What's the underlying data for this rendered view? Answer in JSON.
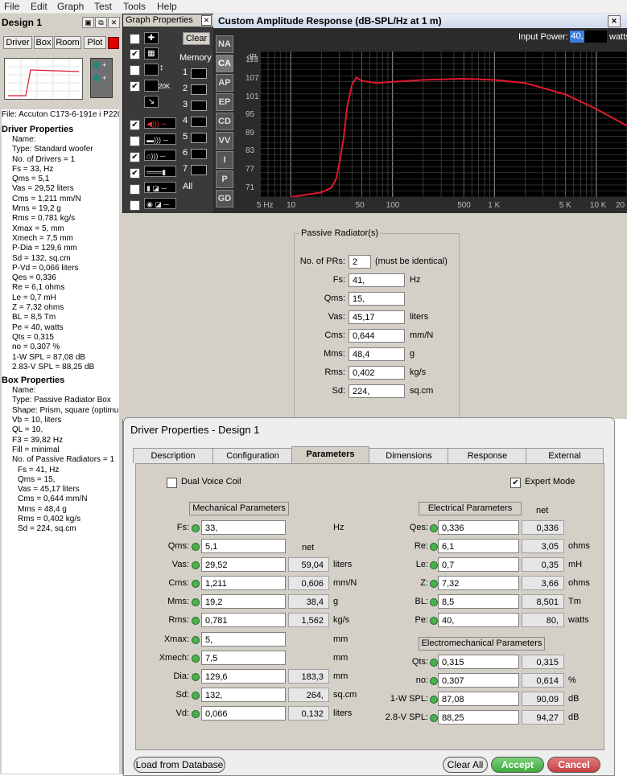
{
  "menu": [
    "File",
    "Edit",
    "Graph",
    "Test",
    "Tools",
    "Help"
  ],
  "design": {
    "title": "Design 1",
    "tabs": [
      "Driver",
      "Box",
      "Room",
      "Plot"
    ],
    "file_line": "File: Accuton C173-6-191e i P220",
    "driver_heading": "Driver Properties",
    "driver_props": [
      "Name:",
      "Type: Standard woofer",
      "No. of Drivers = 1",
      "Fs = 33, Hz",
      "Qms = 5,1",
      "Vas = 29,52 liters",
      "Cms = 1,211 mm/N",
      "Mms = 19,2 g",
      "Rms = 0,781 kg/s",
      "Xmax = 5, mm",
      "Xmech = 7,5 mm",
      "P-Dia = 129,6 mm",
      "Sd = 132, sq.cm",
      "P-Vd = 0,066 liters",
      "Qes = 0,336",
      "Re = 6,1 ohms",
      "Le = 0,7 mH",
      "Z = 7,32 ohms",
      "BL = 8,5 Tm",
      "Pe = 40, watts",
      "Qts = 0,315",
      "no = 0,307 %",
      "1-W SPL = 87,08 dB",
      "2.83-V SPL = 88,25 dB"
    ],
    "box_heading": "Box Properties",
    "box_props": [
      "Name:",
      "Type: Passive Radiator Box",
      "Shape: Prism, square (optimu",
      "Vb = 10, liters",
      "QL = 10,",
      "F3 = 39,82 Hz",
      "Fill = minimal",
      "No. of Passive Radiators = 1"
    ],
    "box_sub": [
      "Fs = 41, Hz",
      "Qms = 15,",
      "Vas = 45,17 liters",
      "Cms = 0,644 mm/N",
      "Mms = 48,4 g",
      "Rms = 0,402 kg/s",
      "Sd = 224, sq.cm"
    ]
  },
  "graph_props": {
    "title": "Graph Properties",
    "clear": "Clear",
    "memory": "Memory",
    "slots": [
      "1",
      "2",
      "3",
      "4",
      "5",
      "6",
      "7"
    ],
    "all": "All",
    "icon_20k": "20K"
  },
  "graph": {
    "title": "Custom Amplitude Response (dB-SPL/Hz at 1 m)",
    "input_power_label": "Input Power:",
    "input_power_value": "40,",
    "input_power_unit": "watts",
    "side_tabs": [
      "NA",
      "CA",
      "AP",
      "EP",
      "CD",
      "VV",
      "I",
      "P",
      "GD"
    ],
    "curve_color": "#e0182d"
  },
  "chart_data": {
    "type": "line",
    "ylabel": "dB",
    "y_ticks": [
      "113",
      "107",
      "101",
      "95",
      "89",
      "83",
      "77",
      "71"
    ],
    "x_ticks": [
      "5 Hz",
      "10",
      "50",
      "100",
      "500",
      "1 K",
      "5 K",
      "10 K",
      "20"
    ],
    "ylim": [
      68,
      116
    ],
    "xlim": [
      5,
      20000
    ],
    "x_scale": "log",
    "series": [
      {
        "x": [
          10,
          20,
          25,
          28,
          30,
          33,
          36,
          40,
          44,
          50,
          70,
          100,
          200,
          500,
          1000,
          2000,
          5000,
          10000,
          20000
        ],
        "y": [
          68,
          69.5,
          71,
          74,
          79,
          87,
          98,
          105,
          107.4,
          106.3,
          105.6,
          106,
          106.6,
          107,
          106.6,
          105.6,
          101.8,
          97,
          91.5
        ]
      }
    ]
  },
  "pr": {
    "title": "Passive Radiator(s)",
    "count_label": "No. of PRs:",
    "count_value": "2",
    "count_note": "(must be identical)",
    "rows": [
      {
        "label": "Fs:",
        "value": "41,",
        "unit": "Hz"
      },
      {
        "label": "Qms:",
        "value": "15,",
        "unit": ""
      },
      {
        "label": "Vas:",
        "value": "45,17",
        "unit": "liters"
      },
      {
        "label": "Cms:",
        "value": "0,644",
        "unit": "mm/N"
      },
      {
        "label": "Mms:",
        "value": "48,4",
        "unit": "g"
      },
      {
        "label": "Rms:",
        "value": "0,402",
        "unit": "kg/s"
      },
      {
        "label": "Sd:",
        "value": "224,",
        "unit": "sq.cm"
      }
    ]
  },
  "dialog": {
    "title": "Driver Properties - Design 1",
    "tabs": [
      "Description",
      "Configuration",
      "Parameters",
      "Dimensions",
      "Response",
      "External"
    ],
    "dual_voice_coil": "Dual Voice Coil",
    "expert_mode": "Expert Mode",
    "expert_checked": "✔",
    "mech_title": "Mechanical Parameters",
    "elec_title": "Electrical Parameters",
    "electromech_title": "Electromechanical Parameters",
    "net": "net",
    "mech": [
      {
        "label": "Fs:",
        "value": "33,",
        "net": "",
        "unit": "Hz"
      },
      {
        "label": "Qms:",
        "value": "5,1",
        "net": "",
        "unit": ""
      },
      {
        "label": "Vas:",
        "value": "29,52",
        "net": "59,04",
        "unit": "liters"
      },
      {
        "label": "Cms:",
        "value": "1,211",
        "net": "0,606",
        "unit": "mm/N"
      },
      {
        "label": "Mms:",
        "value": "19,2",
        "net": "38,4",
        "unit": "g"
      },
      {
        "label": "Rms:",
        "value": "0,781",
        "net": "1,562",
        "unit": "kg/s"
      },
      {
        "label": "Xmax:",
        "value": "5,",
        "net": "",
        "unit": "mm"
      },
      {
        "label": "Xmech:",
        "value": "7,5",
        "net": "",
        "unit": "mm"
      },
      {
        "label": "Dia:",
        "value": "129,6",
        "net": "183,3",
        "unit": "mm"
      },
      {
        "label": "Sd:",
        "value": "132,",
        "net": "264,",
        "unit": "sq.cm"
      },
      {
        "label": "Vd:",
        "value": "0,066",
        "net": "0,132",
        "unit": "liters"
      }
    ],
    "elec": [
      {
        "label": "Qes:",
        "value": "0,336",
        "net": "0,336",
        "unit": ""
      },
      {
        "label": "Re:",
        "value": "6,1",
        "net": "3,05",
        "unit": "ohms"
      },
      {
        "label": "Le:",
        "value": "0,7",
        "net": "0,35",
        "unit": "mH"
      },
      {
        "label": "Z:",
        "value": "7,32",
        "net": "3,66",
        "unit": "ohms"
      },
      {
        "label": "BL:",
        "value": "8,5",
        "net": "8,501",
        "unit": "Tm"
      },
      {
        "label": "Pe:",
        "value": "40,",
        "net": "80,",
        "unit": "watts"
      }
    ],
    "emech": [
      {
        "label": "Qts:",
        "value": "0,315",
        "net": "0,315",
        "unit": ""
      },
      {
        "label": "no:",
        "value": "0,307",
        "net": "0,614",
        "unit": "%"
      },
      {
        "label": "1-W SPL:",
        "value": "87,08",
        "net": "90,09",
        "unit": "dB"
      },
      {
        "label": "2.8-V SPL:",
        "value": "88,25",
        "net": "94,27",
        "unit": "dB"
      }
    ],
    "load_button": "Load from Database",
    "clear_all": "Clear All",
    "accept": "Accept",
    "cancel": "Cancel"
  }
}
